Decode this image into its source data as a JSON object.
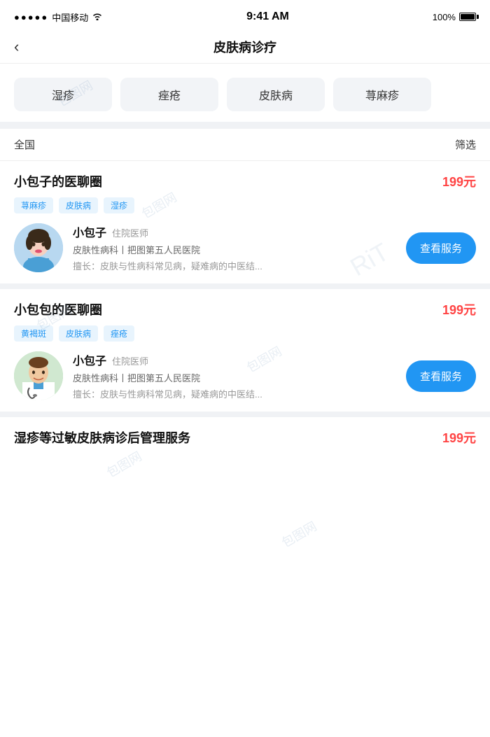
{
  "statusBar": {
    "carrier": "中国移动",
    "time": "9:41 AM",
    "battery": "100%",
    "signal": "●●●●●",
    "wifi": "wifi"
  },
  "navBar": {
    "back": "‹",
    "title": "皮肤病诊疗"
  },
  "tags": [
    {
      "label": "湿疹",
      "active": false
    },
    {
      "label": "痤疮",
      "active": false
    },
    {
      "label": "皮肤病",
      "active": false
    },
    {
      "label": "荨麻疹",
      "active": false
    }
  ],
  "filterBar": {
    "location": "全国",
    "filterLabel": "筛选"
  },
  "cards": [
    {
      "title": "小包子的医聊圈",
      "price": "199元",
      "tags": [
        "荨麻疹",
        "皮肤病",
        "湿疹"
      ],
      "doctor": {
        "name": "小包子",
        "title": "住院医师",
        "hospital": "皮肤性病科丨把图第五人民医院",
        "specialty": "擅长：皮肤与性病科常见病，疑难病的中医结..."
      },
      "btnLabel": "查看服务"
    },
    {
      "title": "小包包的医聊圈",
      "price": "199元",
      "tags": [
        "黄褐斑",
        "皮肤病",
        "痤疮"
      ],
      "doctor": {
        "name": "小包子",
        "title": "住院医师",
        "hospital": "皮肤性病科丨把图第五人民医院",
        "specialty": "擅长：皮肤与性病科常见病，疑难病的中医结..."
      },
      "btnLabel": "查看服务"
    }
  ],
  "bottomCard": {
    "title": "湿疹等过敏皮肤病诊后管理服务",
    "price": "199元"
  }
}
